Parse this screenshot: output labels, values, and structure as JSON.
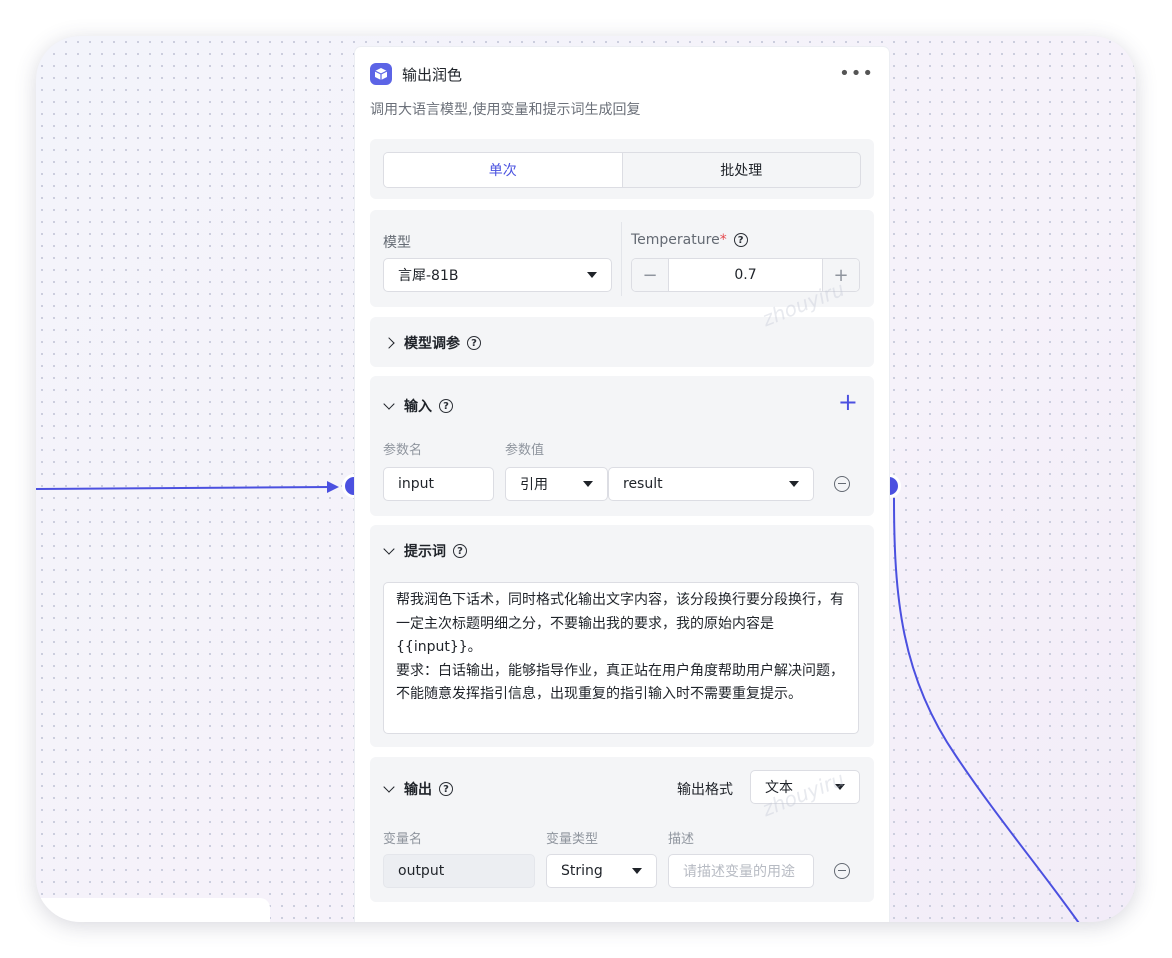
{
  "node": {
    "title": "输出润色",
    "description": "调用大语言模型,使用变量和提示词生成回复",
    "more_icon": "ellipsis-icon",
    "icon": "cube-icon"
  },
  "mode_tabs": {
    "single": "单次",
    "batch": "批处理",
    "active": "single"
  },
  "model": {
    "label": "模型",
    "value": "言犀-81B",
    "temperature_label": "Temperature",
    "required_mark": "*",
    "temperature_value": "0.7",
    "minus": "−",
    "plus": "+"
  },
  "tuning": {
    "title": "模型调参"
  },
  "inputs": {
    "title": "输入",
    "param_name_label": "参数名",
    "param_value_label": "参数值",
    "rows": [
      {
        "name": "input",
        "type": "引用",
        "value": "result"
      }
    ],
    "add": "+"
  },
  "prompt": {
    "title": "提示词",
    "text": "帮我润色下话术，同时格式化输出文字内容，该分段换行要分段换行，有一定主次标题明细之分，不要输出我的要求，我的原始内容是{{input}}。\n要求：白话输出，能够指导作业，真正站在用户角度帮助用户解决问题，不能随意发挥指引信息，出现重复的指引输入时不需要重复提示。"
  },
  "outputs": {
    "title": "输出",
    "format_label": "输出格式",
    "format_value": "文本",
    "var_name_label": "变量名",
    "var_type_label": "变量类型",
    "desc_label": "描述",
    "rows": [
      {
        "name": "output",
        "type": "String",
        "desc_placeholder": "请描述变量的用途"
      }
    ]
  },
  "watermark": "zhouyiru",
  "colors": {
    "accent": "#4b50e0",
    "canvas": "#f4f4f9"
  }
}
